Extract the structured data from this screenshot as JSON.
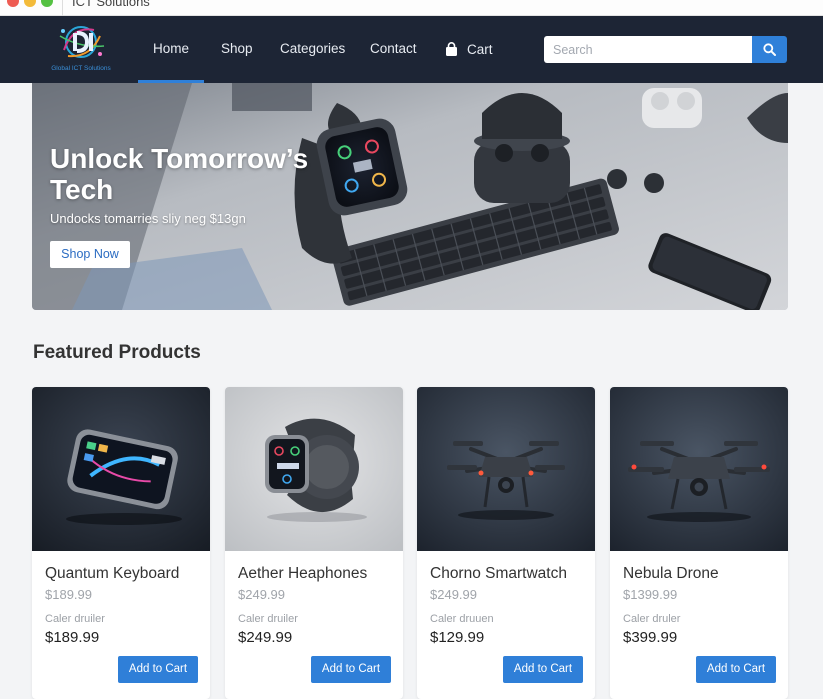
{
  "window": {
    "title": "ICT Solutions"
  },
  "brand": {
    "logo_text": "Global ICT Solutions"
  },
  "nav": {
    "items": [
      {
        "label": "Home",
        "active": true
      },
      {
        "label": "Shop"
      },
      {
        "label": "Categories"
      },
      {
        "label": "Contact"
      }
    ],
    "cart_label": "Cart",
    "cart_icon": "shopping-bag-icon"
  },
  "search": {
    "placeholder": "Search",
    "icon": "search-icon"
  },
  "hero": {
    "title": "Unlock Tomorrow’s Tech",
    "subtitle": "Undocks tomarries sliy neg $13gn",
    "cta_label": "Shop Now"
  },
  "featured": {
    "title": "Featured Products",
    "products": [
      {
        "name": "Quantum Keyboard",
        "old_price": "$189.99",
        "meta": "Caler druiler",
        "price": "$189.99",
        "button": "Add to Cart"
      },
      {
        "name": "Aether Heaphones",
        "old_price": "$249.99",
        "meta": "Caler druiler",
        "price": "$249.99",
        "button": "Add to Cart"
      },
      {
        "name": "Chorno Smartwatch",
        "old_price": "$249.99",
        "meta": "Caler druuen",
        "price": "$129.99",
        "button": "Add to Cart"
      },
      {
        "name": "Nebula Drone",
        "old_price": "$1399.99",
        "meta": "Caler druler",
        "price": "$399.99",
        "button": "Add to Cart"
      }
    ]
  },
  "colors": {
    "navbar": "#1d2535",
    "accent": "#2f80d9",
    "background": "#f3f4f6"
  }
}
